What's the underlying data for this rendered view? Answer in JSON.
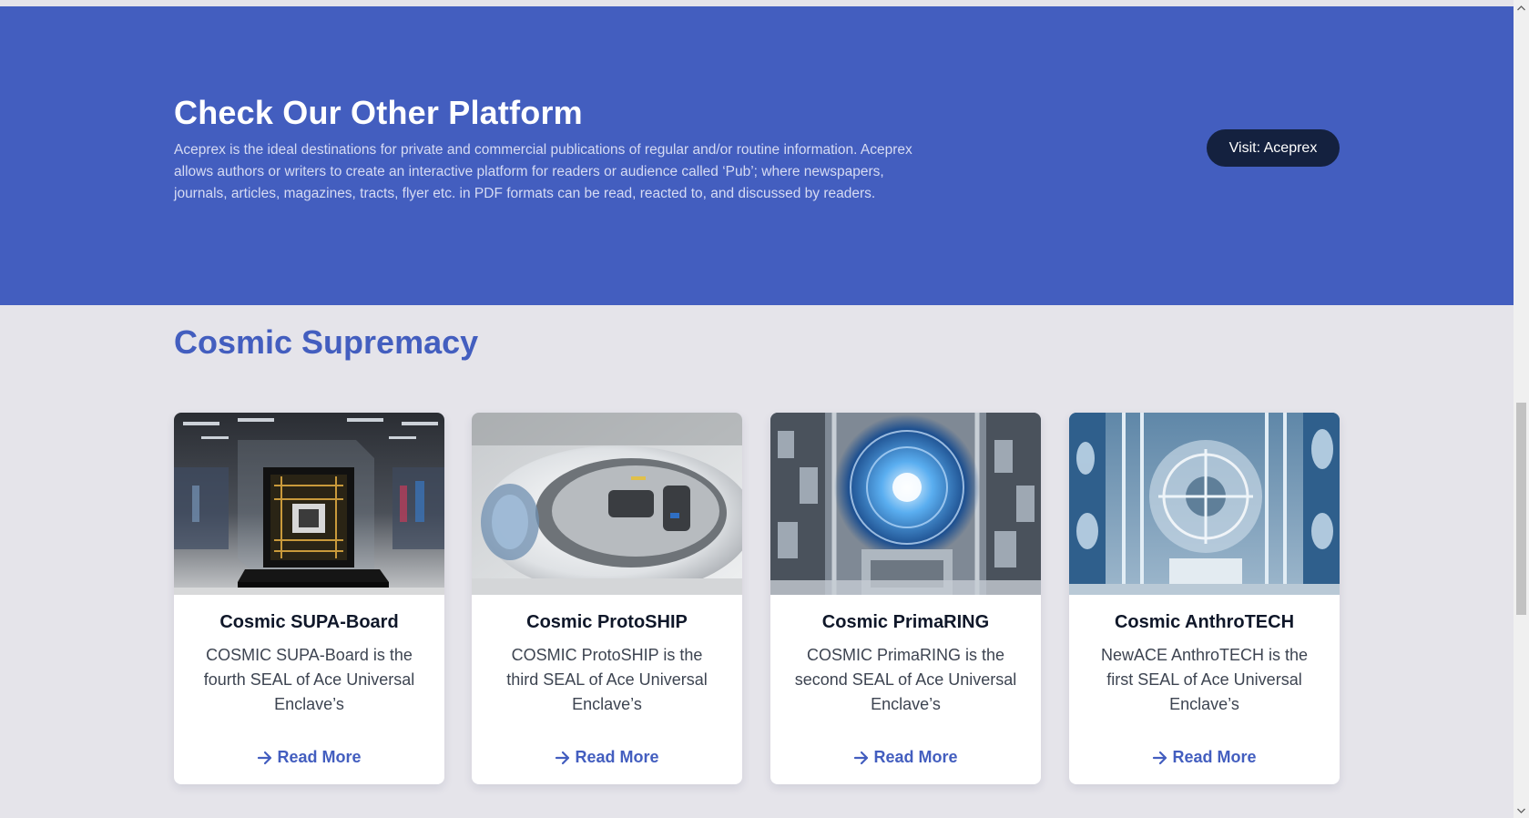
{
  "promo": {
    "title": "Check Our Other Platform",
    "text": "Aceprex is the ideal destinations for private and commercial publications of regular and/or routine information. Aceprex allows authors or writers to create an interactive platform for readers or audience called ‘Pub’; where newspapers, journals, articles, magazines, tracts, flyer etc. in PDF formats can be read, reacted to, and discussed by readers.",
    "button_label": "Visit: Aceprex"
  },
  "section": {
    "title": "Cosmic Supremacy",
    "cards": [
      {
        "title": "Cosmic SUPA-Board",
        "description": "COSMIC SUPA-Board is the fourth SEAL of Ace Universal Enclave’s",
        "link_label": "Read More",
        "image": "glass-cased-circuit-board-image"
      },
      {
        "title": "Cosmic ProtoSHIP",
        "description": "COSMIC ProtoSHIP is the third SEAL of Ace Universal Enclave’s",
        "link_label": "Read More",
        "image": "white-spaceship-pod-image"
      },
      {
        "title": "Cosmic PrimaRING",
        "description": "COSMIC PrimaRING is the second SEAL of Ace Universal Enclave’s",
        "link_label": "Read More",
        "image": "glowing-blue-ring-machine-image"
      },
      {
        "title": "Cosmic AnthroTECH",
        "description": "NewACE AnthroTECH is the first SEAL of Ace Universal Enclave’s",
        "link_label": "Read More",
        "image": "transparent-medical-machine-image"
      }
    ]
  },
  "icons": {
    "read_more": "arrow-right-icon",
    "scroll_up": "chevron-up-icon",
    "scroll_down": "chevron-down-icon"
  },
  "colors": {
    "brand_blue": "#435ebf",
    "button_dark": "#14213f",
    "page_bg": "#e5e4ea"
  }
}
